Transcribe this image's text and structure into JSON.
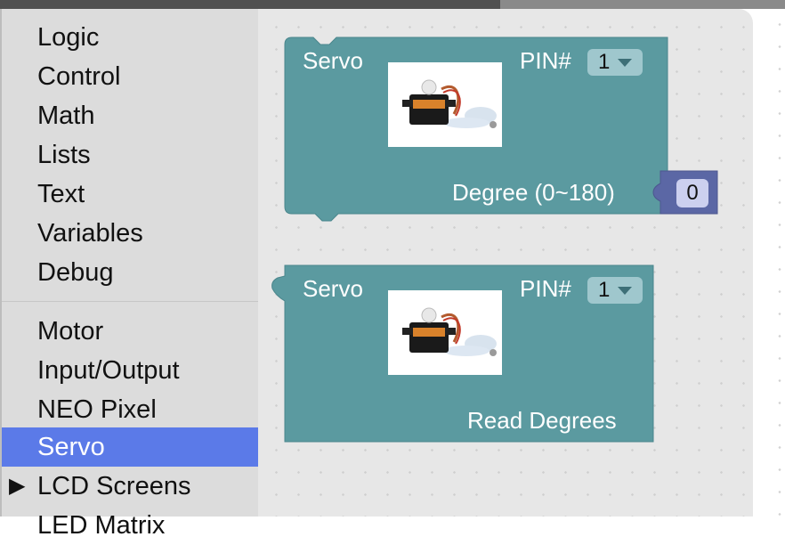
{
  "toolbox": {
    "categories": [
      {
        "label": "Logic"
      },
      {
        "label": "Control"
      },
      {
        "label": "Math"
      },
      {
        "label": "Lists"
      },
      {
        "label": "Text"
      },
      {
        "label": "Variables"
      },
      {
        "label": "Debug"
      },
      {
        "label": "Motor"
      },
      {
        "label": "Input/Output"
      },
      {
        "label": "NEO Pixel"
      },
      {
        "label": "Servo"
      },
      {
        "label": "LCD Screens"
      },
      {
        "label": "LED Matrix"
      }
    ],
    "selected": "Servo",
    "selected_color": "#5b7ae8",
    "expand_icon": "triangle-right-icon"
  },
  "blocks": [
    {
      "title": "Servo",
      "pin_label": "PIN#",
      "pin_value": "1",
      "input_label": "Degree (0~180)",
      "input_value": "0",
      "color": "#5b9aa0",
      "image": "servo-motor-image"
    },
    {
      "title": "Servo",
      "pin_label": "PIN#",
      "pin_value": "1",
      "output_label": "Read Degrees",
      "color": "#5b9aa0",
      "image": "servo-motor-image"
    }
  ],
  "colors": {
    "block": "#5b9aa0",
    "number_block": "#5b67a5"
  }
}
